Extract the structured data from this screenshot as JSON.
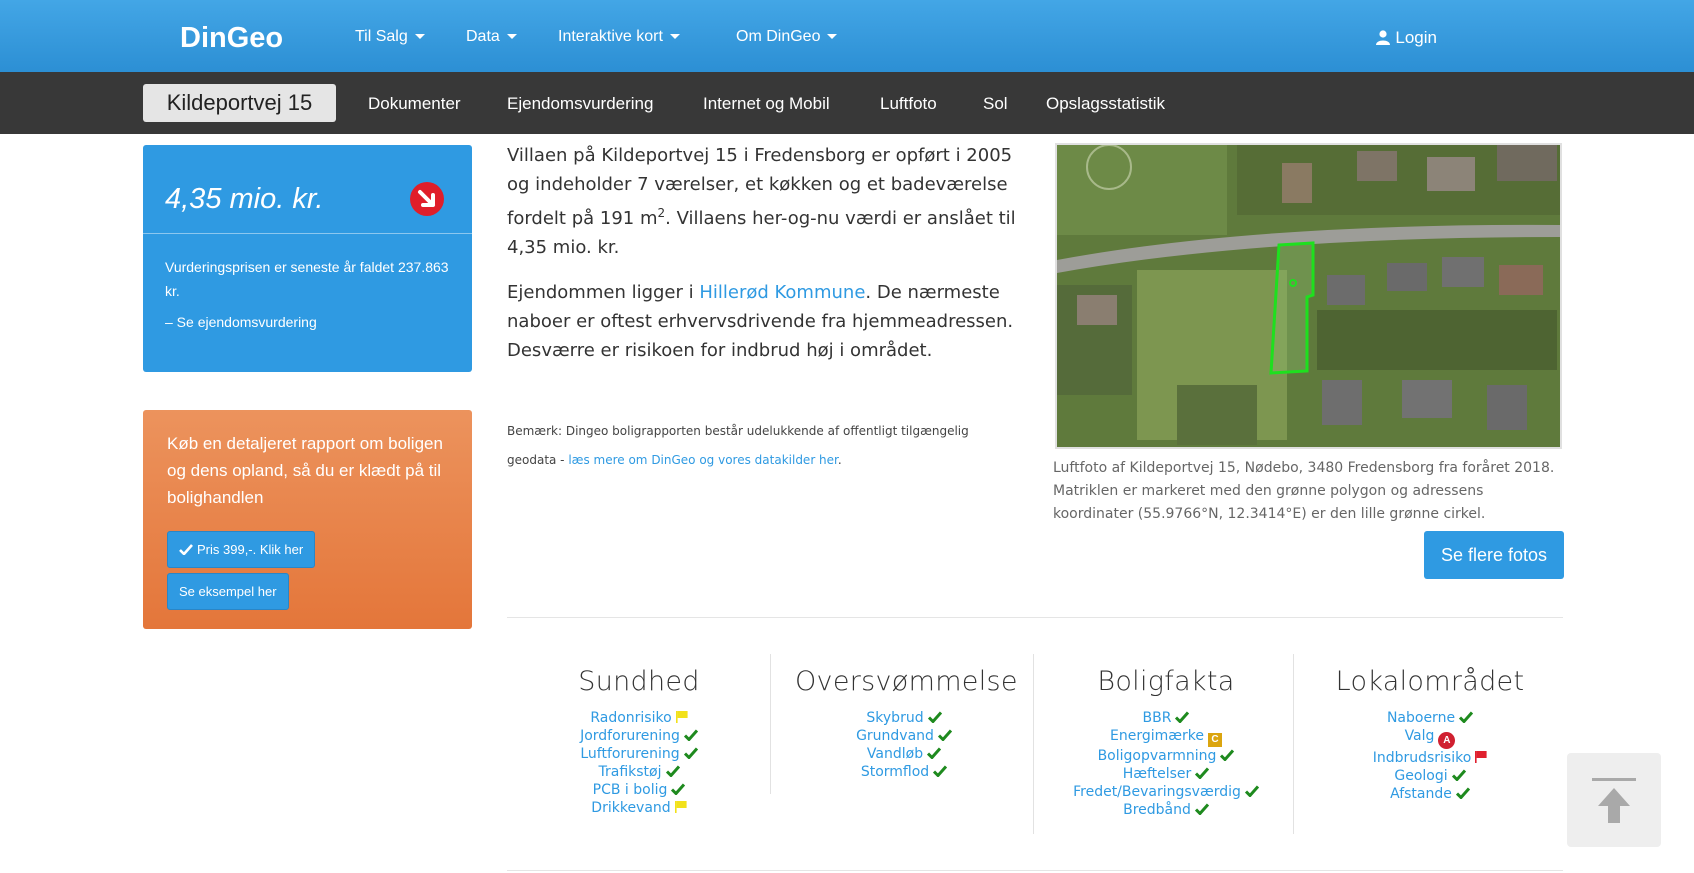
{
  "topnav": {
    "brand": "DinGeo",
    "menus": [
      {
        "label": "Til Salg"
      },
      {
        "label": "Data"
      },
      {
        "label": "Interaktive kort"
      },
      {
        "label": "Om DinGeo"
      }
    ],
    "login": "Login"
  },
  "subnav": {
    "address": "Kildeportvej 15",
    "items": [
      "Dokumenter",
      "Ejendomsvurdering",
      "Internet og Mobil",
      "Luftfoto",
      "Sol",
      "Opslagsstatistik"
    ]
  },
  "price_box": {
    "price": "4,35 mio. kr.",
    "description": "Vurderingsprisen er seneste år faldet 237.863 kr.",
    "link": "– Se ejendomsvurdering",
    "trend_icon": "arrow-down-right-icon"
  },
  "report_box": {
    "text": "Køb en detaljeret rapport om boligen og dens opland, så du er klædt på til bolighandlen",
    "buy_button": "Pris 399,-. Klik her",
    "example_button": "Se eksempel her"
  },
  "intro": {
    "p1a": "Villaen på Kildeportvej 15 i Fredensborg er opført i 2005 og indeholder 7 værelser, et køkken og et badeværelse fordelt på 191 m",
    "p1sup": "2",
    "p1b": ". Villaens her-og-nu værdi er anslået til 4,35 mio. kr.",
    "p2a": "Ejendommen ligger i ",
    "p2link": "Hillerød Kommune",
    "p2b": ". De nærmeste naboer er oftest erhvervsdrivende fra hjemmeadressen. Desværre er risikoen for indbrud høj i området.",
    "note_a": "Bemærk: Dingeo boligrapporten består udelukkende af offentligt tilgængelig geodata - ",
    "note_link": "læs mere om DinGeo og vores datakilder her",
    "note_b": "."
  },
  "photo": {
    "caption": "Luftfoto af Kildeportvej 15, Nødebo, 3480 Fredensborg fra foråret 2018. Matriklen er markeret med den grønne polygon og adressens koordinater (55.9766°N, 12.3414°E) er den lille grønne cirkel.",
    "more_button": "Se flere fotos"
  },
  "categories": [
    {
      "title": "Sundhed",
      "items": [
        {
          "label": "Radonrisiko",
          "status": "flag-yellow"
        },
        {
          "label": "Jordforurening",
          "status": "check"
        },
        {
          "label": "Luftforurening",
          "status": "check"
        },
        {
          "label": "Trafikstøj",
          "status": "check"
        },
        {
          "label": "PCB i bolig",
          "status": "check"
        },
        {
          "label": "Drikkevand",
          "status": "flag-yellow"
        }
      ]
    },
    {
      "title": "Oversvømmelse",
      "items": [
        {
          "label": "Skybrud",
          "status": "check"
        },
        {
          "label": "Grundvand",
          "status": "check"
        },
        {
          "label": "Vandløb",
          "status": "check"
        },
        {
          "label": "Stormflod",
          "status": "check"
        }
      ]
    },
    {
      "title": "Boligfakta",
      "items": [
        {
          "label": "BBR",
          "status": "check"
        },
        {
          "label": "Energimærke",
          "status": "badge-c",
          "badge": "C"
        },
        {
          "label": "Boligopvarmning",
          "status": "check"
        },
        {
          "label": "Hæftelser",
          "status": "check"
        },
        {
          "label": "Fredet/Bevaringsværdig",
          "status": "check"
        },
        {
          "label": "Bredbånd",
          "status": "check"
        }
      ]
    },
    {
      "title": "Lokalområdet",
      "items": [
        {
          "label": "Naboerne",
          "status": "check"
        },
        {
          "label": "Valg",
          "status": "badge-a",
          "badge": "A"
        },
        {
          "label": "Indbrudsrisiko",
          "status": "flag-red"
        },
        {
          "label": "Geologi",
          "status": "check"
        },
        {
          "label": "Afstande",
          "status": "check"
        }
      ]
    }
  ],
  "colors": {
    "brand_blue": "#2f9ae2",
    "subnav_dark": "#383838",
    "report_orange": "#e4763a",
    "check_green": "#1e8a1e",
    "flag_yellow": "#f2e11a",
    "flag_red": "#e0202e"
  }
}
